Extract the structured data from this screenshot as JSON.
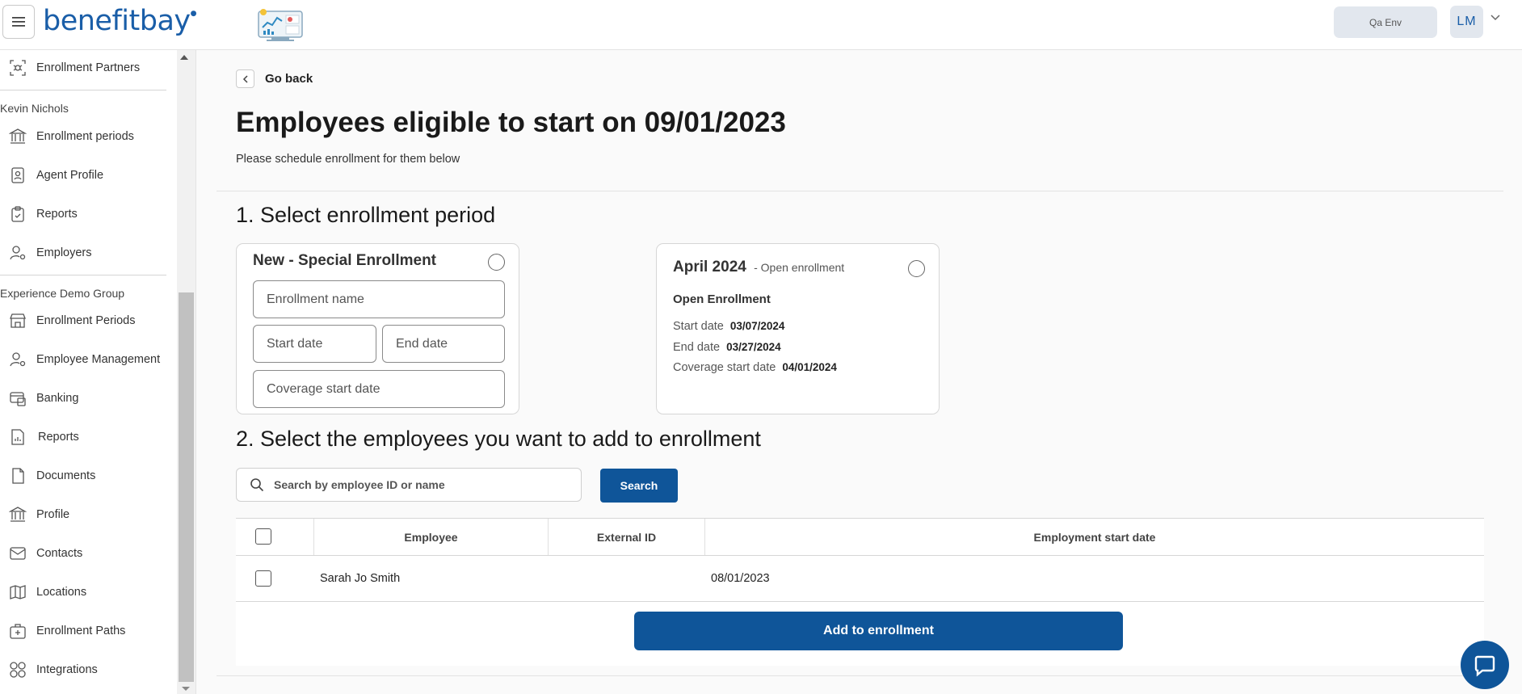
{
  "header": {
    "brand": "benefitbay",
    "env_label": "Qa Env",
    "user_initials": "LM"
  },
  "sidebar": {
    "top_item": "Enrollment Partners",
    "group1": {
      "name": "Kevin Nichols",
      "items": [
        "Enrollment periods",
        "Agent Profile",
        "Reports",
        "Employers"
      ]
    },
    "group2": {
      "name": "Experience Demo Group",
      "items": [
        "Enrollment Periods",
        "Employee Management",
        "Banking",
        "Reports",
        "Documents",
        "Profile",
        "Contacts",
        "Locations",
        "Enrollment Paths",
        "Integrations"
      ]
    }
  },
  "main": {
    "go_back": "Go back",
    "title": "Employees eligible to start on 09/01/2023",
    "subtitle": "Please schedule enrollment for them below",
    "step1": "1. Select enrollment period",
    "new_card": {
      "title": "New - Special Enrollment",
      "name_placeholder": "Enrollment name",
      "start_placeholder": "Start date",
      "end_placeholder": "End date",
      "coverage_placeholder": "Coverage start date"
    },
    "period_card": {
      "title": "April 2024",
      "type_label": "- Open enrollment",
      "name": "Open Enrollment",
      "start_label": "Start date",
      "start_value": "03/07/2024",
      "end_label": "End date",
      "end_value": "03/27/2024",
      "coverage_label": "Coverage start date",
      "coverage_value": "04/01/2024"
    },
    "step2": "2. Select the employees you want to add to enrollment",
    "search_placeholder": "Search by employee ID or name",
    "search_button": "Search",
    "table": {
      "columns": [
        "Employee",
        "External ID",
        "Employment start date"
      ],
      "rows": [
        {
          "employee": "Sarah Jo Smith",
          "external_id": "",
          "start_date": "08/01/2023"
        }
      ]
    },
    "add_button": "Add to enrollment"
  }
}
